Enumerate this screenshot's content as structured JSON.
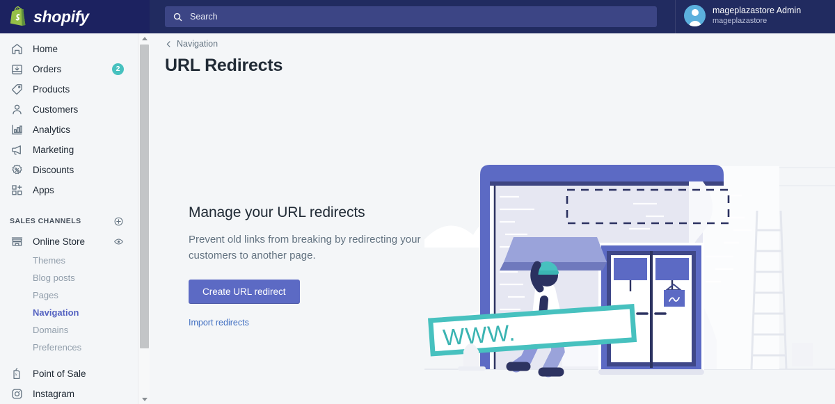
{
  "brand": {
    "name": "shopify",
    "logo_icon": "shopify-bag-icon"
  },
  "topbar": {
    "search": {
      "placeholder": "Search",
      "icon": "search-icon"
    },
    "account": {
      "name": "mageplazastore Admin",
      "store": "mageplazastore",
      "avatar_icon": "user-avatar-icon"
    }
  },
  "sidebar": {
    "items": [
      {
        "label": "Home",
        "icon": "home-icon",
        "badge": null
      },
      {
        "label": "Orders",
        "icon": "orders-inbox-icon",
        "badge": "2"
      },
      {
        "label": "Products",
        "icon": "tag-icon",
        "badge": null
      },
      {
        "label": "Customers",
        "icon": "person-icon",
        "badge": null
      },
      {
        "label": "Analytics",
        "icon": "bar-chart-icon",
        "badge": null
      },
      {
        "label": "Marketing",
        "icon": "megaphone-icon",
        "badge": null
      },
      {
        "label": "Discounts",
        "icon": "percent-badge-icon",
        "badge": null
      },
      {
        "label": "Apps",
        "icon": "apps-grid-plus-icon",
        "badge": null
      }
    ],
    "sales_channels": {
      "header": "SALES CHANNELS",
      "add_icon": "plus-circle-icon",
      "online_store": {
        "label": "Online Store",
        "icon": "storefront-icon",
        "view_icon": "eye-icon"
      },
      "sub_items": [
        {
          "label": "Themes",
          "active": false
        },
        {
          "label": "Blog posts",
          "active": false
        },
        {
          "label": "Pages",
          "active": false
        },
        {
          "label": "Navigation",
          "active": true
        },
        {
          "label": "Domains",
          "active": false
        },
        {
          "label": "Preferences",
          "active": false
        }
      ]
    },
    "channels": [
      {
        "label": "Point of Sale",
        "icon": "point-of-sale-icon"
      },
      {
        "label": "Instagram",
        "icon": "instagram-icon"
      }
    ],
    "scrollbar": {
      "up_icon": "scroll-up-arrow-icon",
      "down_icon": "scroll-down-arrow-icon"
    }
  },
  "main": {
    "breadcrumb": {
      "label": "Navigation",
      "icon": "chevron-left-icon"
    },
    "page_title": "URL Redirects",
    "empty_state": {
      "heading": "Manage your URL redirects",
      "description": "Prevent old links from breaking by redirecting your customers to another page.",
      "primary_button": "Create URL redirect",
      "secondary_link": "Import redirects",
      "illustration_sign_text": "WWW."
    }
  },
  "colors": {
    "brand_navy": "#1c2260",
    "topbar_navy": "#212b60",
    "accent_indigo": "#5c6ac4",
    "badge_teal": "#47c1bf",
    "link_blue": "#3f6ec1",
    "page_bg": "#f4f6f8",
    "sign_teal": "#47c1bf"
  }
}
